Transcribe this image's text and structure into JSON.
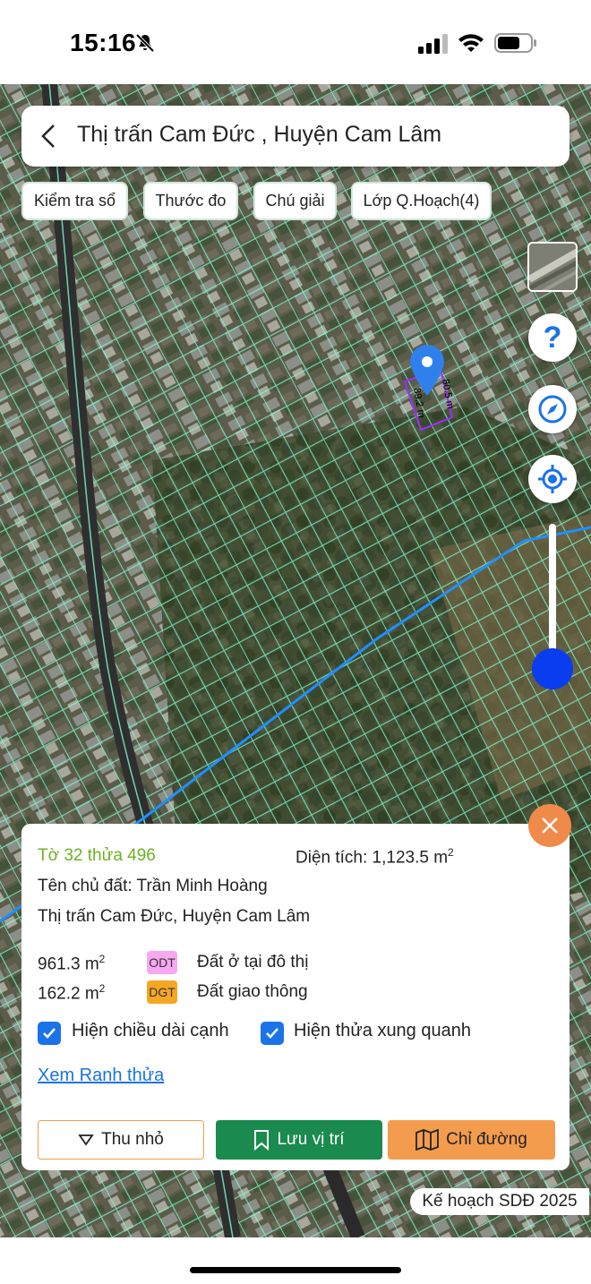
{
  "status": {
    "time": "15:16"
  },
  "header": {
    "title": "Thị trấn Cam Đức , Huyện Cam Lâm"
  },
  "chips": [
    {
      "label": "Kiểm tra sổ"
    },
    {
      "label": "Thước đo"
    },
    {
      "label": "Chú giải"
    },
    {
      "label": "Lớp Q.Hoạch(4)"
    }
  ],
  "map": {
    "edge_label_1": "89.2 m",
    "edge_label_2": "80.5 m",
    "zoom_level": 0.85,
    "plan_label": "Kế hoạch SDĐ 2025"
  },
  "panel": {
    "parcel": "Tờ 32 thửa 496",
    "area_label": "Diện tích: 1,123.5 m",
    "area_sup": "2",
    "owner": "Tên chủ đất: Trần Minh Hoàng",
    "address": "Thị trấn Cam Đức, Huyện Cam Lâm",
    "land_uses": [
      {
        "area": "961.3 m",
        "sup": "2",
        "code": "ODT",
        "code_color": "#f6a8f0",
        "name": "Đất ở tại đô thị"
      },
      {
        "area": "162.2 m",
        "sup": "2",
        "code": "DGT",
        "code_color": "#f5a623",
        "name": "Đất giao thông"
      }
    ],
    "checkboxes": [
      {
        "label": "Hiện chiều dài cạnh",
        "checked": true
      },
      {
        "label": "Hiện thửa xung quanh",
        "checked": true
      }
    ],
    "link": "Xem Ranh thửa",
    "buttons": {
      "collapse": "Thu nhỏ",
      "save": "Lưu vị trí",
      "directions": "Chỉ đường"
    }
  },
  "colors": {
    "save_button": "#1a8a4e",
    "directions_button": "#f39c4e",
    "close_button": "#f08a4b",
    "parcel_green": "#6cb224",
    "parcel_lines": "#7fffd4",
    "route_line": "#1e90ff",
    "pin": "#2f80ed"
  }
}
